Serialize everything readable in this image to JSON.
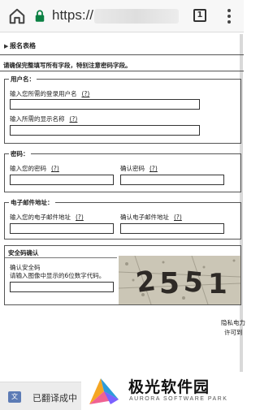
{
  "browser": {
    "url_prefix": "https://",
    "tab_count": "1"
  },
  "page": {
    "section_title": "报名表格",
    "instructions": "请确保完整填写所有字段，特别注意密码字段。",
    "username_group": {
      "legend": "用户名：",
      "login_label": "输入您所需的登录用户名",
      "display_label": "输入所需的显示名称",
      "help": "(?)"
    },
    "password_group": {
      "legend": "密码：",
      "password_label": "输入您的密码",
      "confirm_label": "确认密码",
      "help": "(?)"
    },
    "email_group": {
      "legend": "电子邮件地址：",
      "email_label": "输入您的电子邮件地址",
      "confirm_label": "确认电子邮件地址",
      "help": "(?)"
    },
    "captcha": {
      "title": "安全码确认",
      "label1": "确认安全码",
      "label2": "请输入图像中显示的6位数字代码。"
    },
    "side_text": {
      "line1": "隐私电力",
      "line2": "许可到"
    }
  },
  "translate_bar": {
    "status": "已翻译成中"
  },
  "watermark": {
    "name": "极光软件园",
    "sub": "AURORA SOFTWARE PARK"
  }
}
